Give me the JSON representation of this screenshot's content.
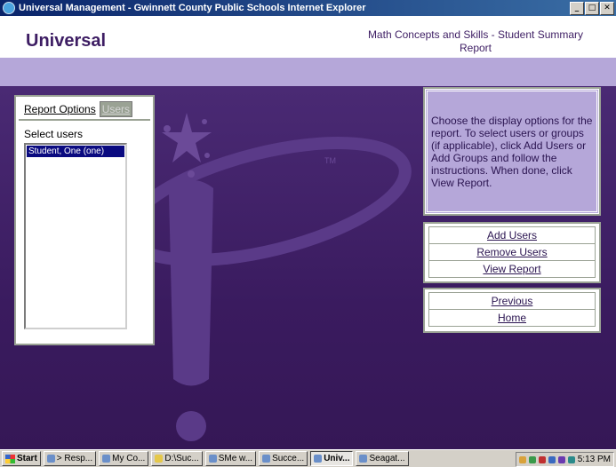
{
  "window": {
    "title": "Universal Management - Gwinnett County Public Schools Internet Explorer",
    "buttons": [
      "_",
      "□",
      "✕"
    ]
  },
  "header": {
    "brand": "Universal",
    "report_title": "Math Concepts and Skills - Student Summary Report"
  },
  "left_panel": {
    "tabs": [
      "Report Options",
      "Users"
    ],
    "active_tab": "Report Options",
    "select_label": "Select users",
    "users": [
      "Student, One (one)"
    ]
  },
  "info": {
    "text": "Choose the display options for the report. To select users or groups (if applicable), click Add Users or Add Groups and follow the instructions. When done, click View Report."
  },
  "actions": {
    "add_users": "Add Users",
    "remove_users": "Remove Users",
    "view_report": "View Report",
    "previous": "Previous",
    "home": "Home"
  },
  "logo_mark": "TM",
  "taskbar": {
    "start": "Start",
    "tasks": [
      "> Resp...",
      "My Co...",
      "D:\\Suc...",
      "SMe w...",
      "Succe...",
      "Univ...",
      "Seagat..."
    ],
    "active_task": "Univ...",
    "clock": "5:13 PM"
  },
  "colors": {
    "purple_dark": "#3d1d63",
    "lavender": "#b5a7d9",
    "border_gray": "#9aa294"
  }
}
